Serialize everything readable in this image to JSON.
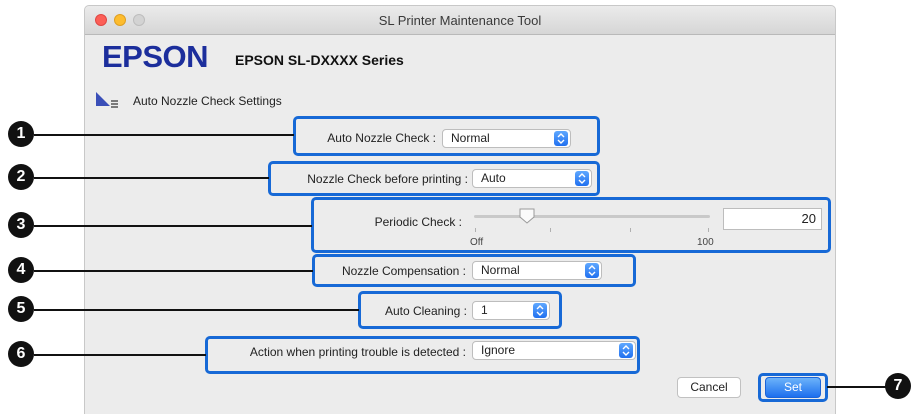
{
  "window": {
    "title": "SL Printer Maintenance Tool"
  },
  "brand": {
    "logo": "EPSON",
    "model": "EPSON SL-DXXXX Series"
  },
  "section": {
    "title": "Auto Nozzle Check Settings",
    "icon": "nozzle-check-icon"
  },
  "settings": {
    "auto_nozzle_check": {
      "label": "Auto Nozzle Check :",
      "value": "Normal"
    },
    "nozzle_check_before_printing": {
      "label": "Nozzle Check before printing :",
      "value": "Auto"
    },
    "periodic_check": {
      "label": "Periodic Check :",
      "min_label": "Off",
      "max_label": "100",
      "value": "20",
      "slider_fraction": 0.2
    },
    "nozzle_compensation": {
      "label": "Nozzle Compensation :",
      "value": "Normal"
    },
    "auto_cleaning": {
      "label": "Auto Cleaning :",
      "value": "1"
    },
    "action_on_trouble": {
      "label": "Action when printing trouble is detected :",
      "value": "Ignore"
    }
  },
  "buttons": {
    "cancel": "Cancel",
    "set": "Set"
  },
  "callouts": [
    "1",
    "2",
    "3",
    "4",
    "5",
    "6",
    "7"
  ],
  "colors": {
    "highlight": "#1769d6",
    "logo": "#1c2e9c",
    "accent_button": "#1d6fee"
  }
}
